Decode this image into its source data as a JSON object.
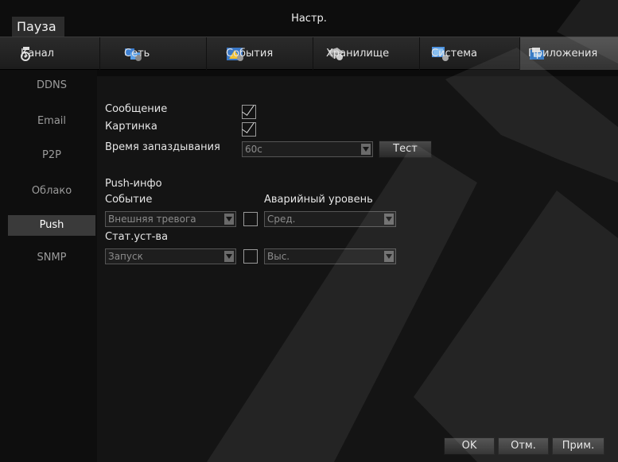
{
  "window": {
    "title": "Настр.",
    "pause_label": "Пауза"
  },
  "tabs": [
    {
      "label": "Канал",
      "icon": "channel-icon"
    },
    {
      "label": "Сеть",
      "icon": "network-icon"
    },
    {
      "label": "События",
      "icon": "events-icon"
    },
    {
      "label": "Хранилище",
      "icon": "storage-icon"
    },
    {
      "label": "Система",
      "icon": "system-icon"
    },
    {
      "label": "Приложения",
      "icon": "apps-icon",
      "active": true
    }
  ],
  "sidebar": {
    "items": [
      {
        "label": "DDNS"
      },
      {
        "label": "Email"
      },
      {
        "label": "P2P"
      },
      {
        "label": "Облако"
      },
      {
        "label": "Push",
        "active": true
      },
      {
        "label": "SNMP"
      }
    ]
  },
  "form": {
    "message_label": "Сообщение",
    "message_checked": true,
    "picture_label": "Картинка",
    "picture_checked": true,
    "delay_label": "Время запаздывания",
    "delay_value": "60с",
    "test_label": "Тест",
    "push_info_label": "Push-инфо",
    "event_label": "Событие",
    "alarm_level_label": "Аварийный уровень",
    "event_value": "Внешняя тревога",
    "event_checked": false,
    "event_level_value": "Сред.",
    "device_status_label": "Стат.уст-ва",
    "status_value": "Запуск",
    "status_checked": false,
    "status_level_value": "Выс."
  },
  "footer": {
    "ok_label": "OK",
    "cancel_label": "Отм.",
    "apply_label": "Прим."
  },
  "colors": {
    "background": "#0b0b0b",
    "panel": "#141414",
    "active_side": "#3a3a3a"
  }
}
